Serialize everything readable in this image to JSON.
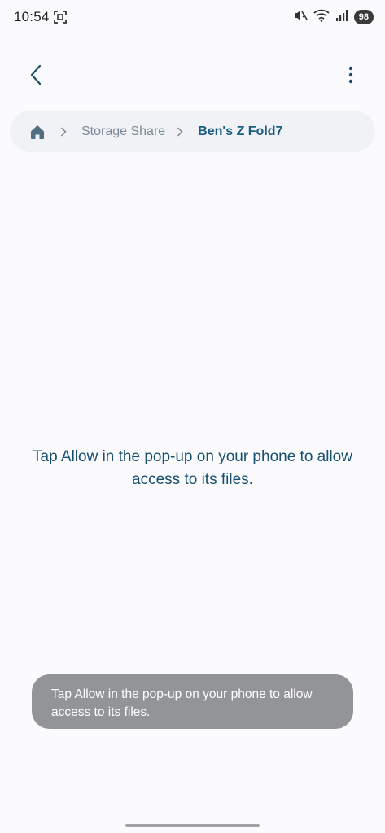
{
  "status_bar": {
    "time": "10:54",
    "battery": "98",
    "icons": [
      "screenshot-icon",
      "mute-icon",
      "wifi-icon",
      "signal-icon",
      "battery-icon"
    ]
  },
  "app_bar": {
    "back_icon": "chevron-left-icon",
    "menu_icon": "more-vertical-icon"
  },
  "breadcrumb": {
    "home_icon": "home-icon",
    "items": [
      "Storage Share",
      "Ben's Z Fold7"
    ]
  },
  "main": {
    "message": "Tap Allow in the pop-up on your phone to allow access to its files."
  },
  "toast": {
    "message": "Tap Allow in the pop-up on your phone to allow access to its files."
  },
  "colors": {
    "accent": "#1a5e82",
    "background": "#fbfbfd",
    "toast_bg": "#939497"
  }
}
